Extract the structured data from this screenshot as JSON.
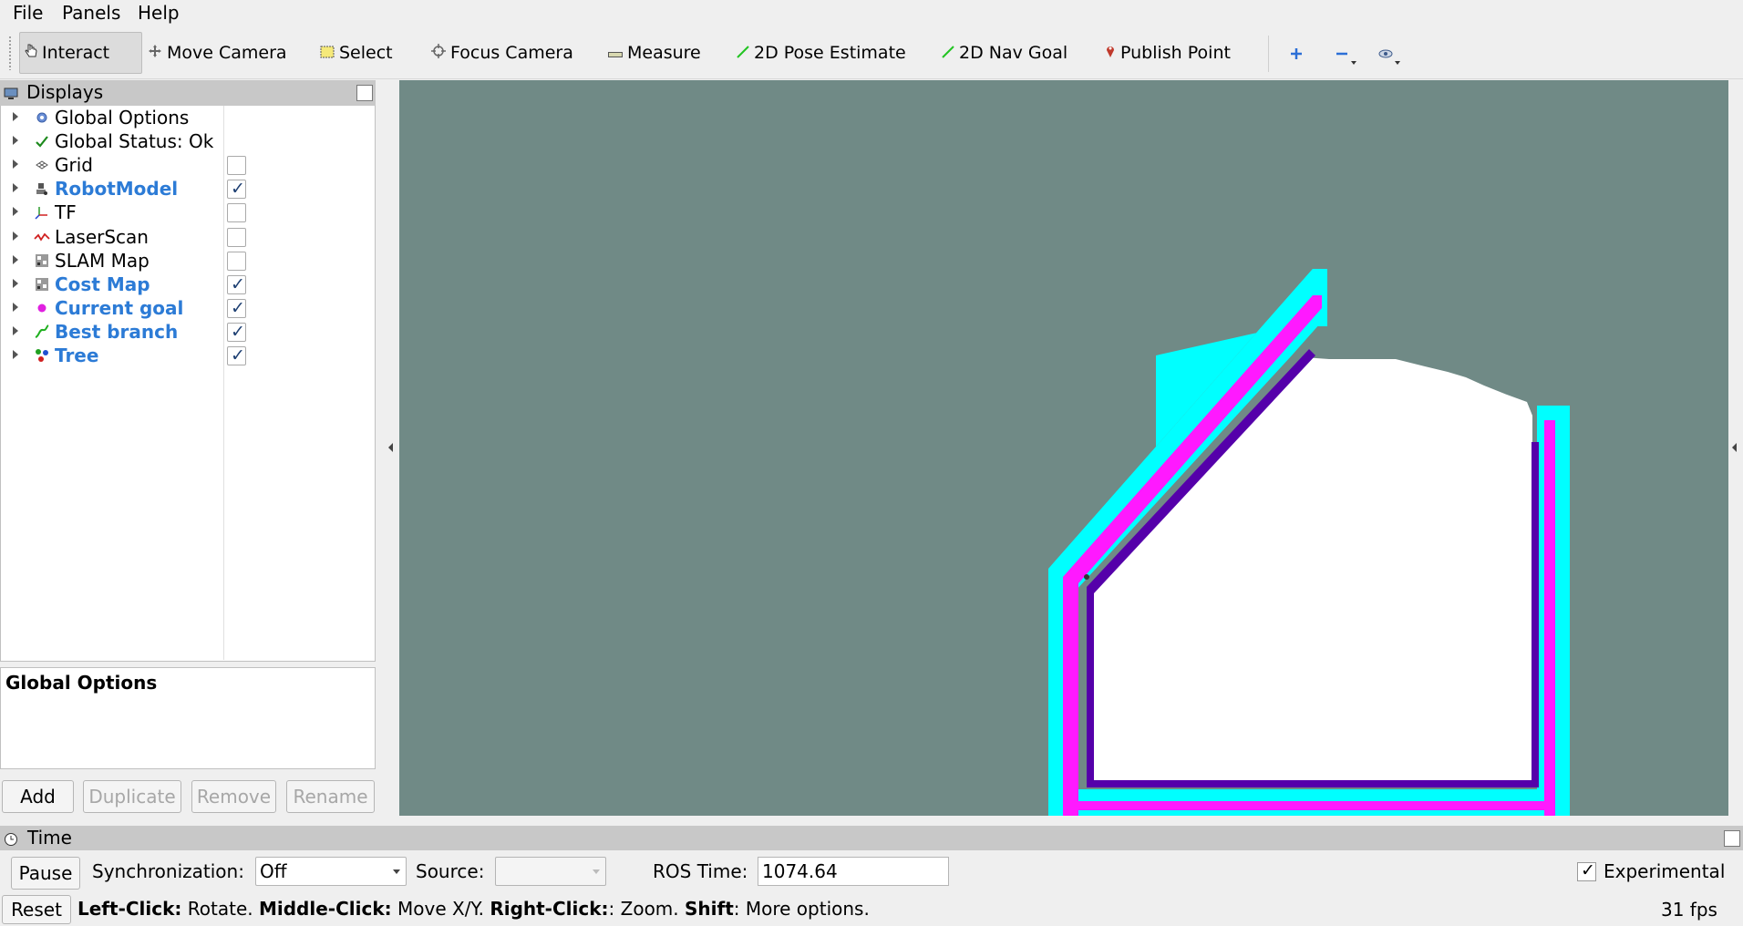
{
  "menu": {
    "file": "File",
    "panels": "Panels",
    "help": "Help"
  },
  "toolbar": {
    "interact": "Interact",
    "move_camera": "Move Camera",
    "select": "Select",
    "focus_camera": "Focus Camera",
    "measure": "Measure",
    "pose_estimate": "2D Pose Estimate",
    "nav_goal": "2D Nav Goal",
    "publish_point": "Publish Point"
  },
  "displays": {
    "title": "Displays",
    "items": [
      {
        "label": "Global Options",
        "icon": "gear-icon",
        "checkbox": false
      },
      {
        "label": "Global Status: Ok",
        "icon": "check-icon",
        "checkbox": false
      },
      {
        "label": "Grid",
        "icon": "grid-icon",
        "checkbox": true,
        "checked": false
      },
      {
        "label": "RobotModel",
        "icon": "robot-icon",
        "checkbox": true,
        "checked": true
      },
      {
        "label": "TF",
        "icon": "axes-icon",
        "checkbox": true,
        "checked": false
      },
      {
        "label": "LaserScan",
        "icon": "laser-icon",
        "checkbox": true,
        "checked": false
      },
      {
        "label": "SLAM Map",
        "icon": "map-icon",
        "checkbox": true,
        "checked": false
      },
      {
        "label": "Cost Map",
        "icon": "map-icon",
        "checkbox": true,
        "checked": true
      },
      {
        "label": "Current goal",
        "icon": "dot-icon",
        "checkbox": true,
        "checked": true
      },
      {
        "label": "Best branch",
        "icon": "path-icon",
        "checkbox": true,
        "checked": true
      },
      {
        "label": "Tree",
        "icon": "tree-icon",
        "checkbox": true,
        "checked": true
      }
    ]
  },
  "description": {
    "title": "Global Options"
  },
  "buttons": {
    "add": "Add",
    "duplicate": "Duplicate",
    "remove": "Remove",
    "rename": "Rename"
  },
  "time": {
    "title": "Time",
    "pause": "Pause",
    "sync_label": "Synchronization:",
    "sync_value": "Off",
    "source_label": "Source:",
    "source_value": "",
    "ros_time_label": "ROS Time:",
    "ros_time_value": "1074.64",
    "experimental": "Experimental",
    "experimental_checked": true
  },
  "status": {
    "reset": "Reset",
    "left_key": "Left-Click:",
    "left_val": " Rotate. ",
    "middle_key": "Middle-Click:",
    "middle_val": " Move X/Y. ",
    "right_key": "Right-Click:",
    "right_val": ": Zoom. ",
    "shift_key": "Shift",
    "shift_val": ": More options.",
    "fps": "31 fps"
  },
  "colors": {
    "viewport_bg": "#708a86",
    "costmap_cyan": "#00ffff",
    "costmap_magenta": "#ff19ff",
    "costmap_purple": "#5500aa",
    "free_space": "#ffffff",
    "enabled_label": "#2c7bd6"
  }
}
